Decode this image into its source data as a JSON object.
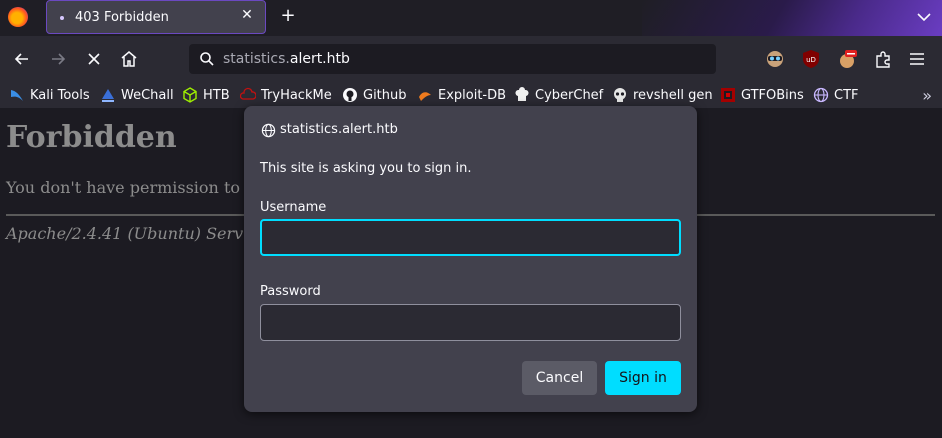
{
  "tab": {
    "title": "403 Forbidden"
  },
  "url": {
    "host_prefix": "statistics.",
    "host_domain": "alert.htb"
  },
  "bookmarks": [
    {
      "label": "Kali Tools",
      "icon": "kali-icon"
    },
    {
      "label": "WeChall",
      "icon": "wechall-icon"
    },
    {
      "label": "HTB",
      "icon": "htb-icon"
    },
    {
      "label": "TryHackMe",
      "icon": "tryhackme-icon"
    },
    {
      "label": "Github",
      "icon": "github-icon"
    },
    {
      "label": "Exploit-DB",
      "icon": "exploitdb-icon"
    },
    {
      "label": "CyberChef",
      "icon": "cyberchef-icon"
    },
    {
      "label": "revshell gen",
      "icon": "skull-icon"
    },
    {
      "label": "GTFOBins",
      "icon": "gtfobins-icon"
    },
    {
      "label": "CTF",
      "icon": "globe-icon"
    }
  ],
  "page": {
    "heading": "Forbidden",
    "message": "You don't have permission to",
    "server": "Apache/2.4.41 (Ubuntu) Serv"
  },
  "dialog": {
    "host": "statistics.alert.htb",
    "message": "This site is asking you to sign in.",
    "username_label": "Username",
    "username_value": "",
    "password_label": "Password",
    "password_value": "",
    "cancel_label": "Cancel",
    "signin_label": "Sign in"
  },
  "colors": {
    "accent": "#00ddff",
    "tab_border": "#6b49c1"
  }
}
